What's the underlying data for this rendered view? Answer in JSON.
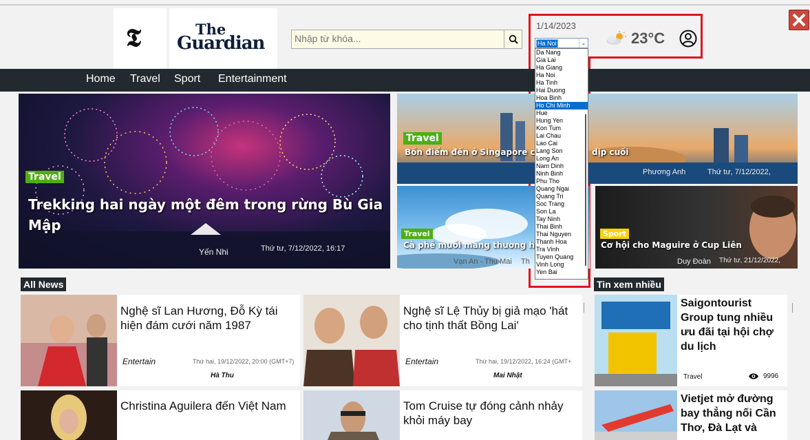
{
  "header": {
    "nyt_logo": "𝕿",
    "guardian_line1": "The",
    "guardian_line2": "Guardian",
    "search_placeholder": "Nhập từ khóa...",
    "date": "1/14/2023",
    "city_selected": "Ha Noi",
    "temperature": "23°C"
  },
  "nav": [
    "Home",
    "Travel",
    "Sport",
    "Entertainment"
  ],
  "hero": {
    "tag": "Travel",
    "title": "Trekking hai ngày một đêm trong rừng Bù Gia Mập",
    "author": "Yến Nhi",
    "date": "Thứ tư, 7/12/2022, 16:17"
  },
  "top_right": {
    "tag": "Travel",
    "title": "Bốn điểm đến ở Singapore cho chuyến đi dịp cuối",
    "title_left": "Bốn điểm đến ở Singapore c",
    "title_right": "dịp cuối",
    "author": "Phương Anh",
    "date": "Thứ tư, 7/12/2022,"
  },
  "mid_left": {
    "tag": "Travel",
    "title": "Cà phê muối mang thương hiệu",
    "author": "Vạn An - Thu Mai",
    "date_fragment": "Th"
  },
  "mid_right": {
    "tag": "Sport",
    "title": "Cơ hội cho Maguire ở Cup Liên",
    "author": "Duy Đoàn",
    "date": "Thứ tư, 21/12/2022,"
  },
  "dropdown": {
    "items": [
      "Da Nang",
      "Gia Lai",
      "Ha Giang",
      "Ha Noi",
      "Ha Tinh",
      "Hai Duong",
      "Hoa Binh",
      "Ho Chi Minh",
      "Hue",
      "Hung Yen",
      "Kon Tum",
      "Lai Chau",
      "Lao Cai",
      "Lang Son",
      "Long An",
      "Nam Dinh",
      "Ninh Binh",
      "Phu Tho",
      "Quang Ngai",
      "Quang Tri",
      "Soc Trang",
      "Son La",
      "Tay Ninh",
      "Thai Binh",
      "Thai Nguyen",
      "Thanh Hoa",
      "Tra Vinh",
      "Tuyen Quang",
      "Vinh Long",
      "Yen Bai"
    ],
    "highlighted": "Ho Chi Minh"
  },
  "all_news": {
    "title": "All News",
    "items": [
      {
        "title": "Nghệ sĩ Lan Hương, Đỗ Kỳ tái hiện đám cưới năm 1987",
        "category": "Entertain",
        "date": "Thứ hai, 19/12/2022, 20:00 (GMT+7)",
        "author": "Hà Thu"
      },
      {
        "title": "Nghệ sĩ Lệ Thủy bị giả mạo 'hát cho tịnh thất Bồng Lai'",
        "category": "Entertain",
        "date": "Thứ hai, 19/12/2022, 16:24 (GMT+",
        "author": "Mai Nhật"
      },
      {
        "title": "Christina Aguilera đến Việt Nam",
        "category": "",
        "date": "",
        "author": ""
      },
      {
        "title": "Tom Cruise tự đóng cảnh nhảy khỏi máy bay",
        "category": "",
        "date": "",
        "author": ""
      }
    ]
  },
  "most_viewed": {
    "title": "Tin xem nhiều",
    "items": [
      {
        "title": "Saigontourist Group tung nhiều ưu đãi tại hội chợ du lịch",
        "category": "Travel",
        "views": "9996"
      },
      {
        "title": "Vietjet mở đường bay thẳng nối Cần Thơ, Đà Lạt và",
        "category": "",
        "views": ""
      }
    ]
  },
  "colors": {
    "navbar": "#232a2f",
    "highlight_border": "#e0141e",
    "travel_tag": "#4caf14",
    "sport_tag": "#f7d010"
  }
}
